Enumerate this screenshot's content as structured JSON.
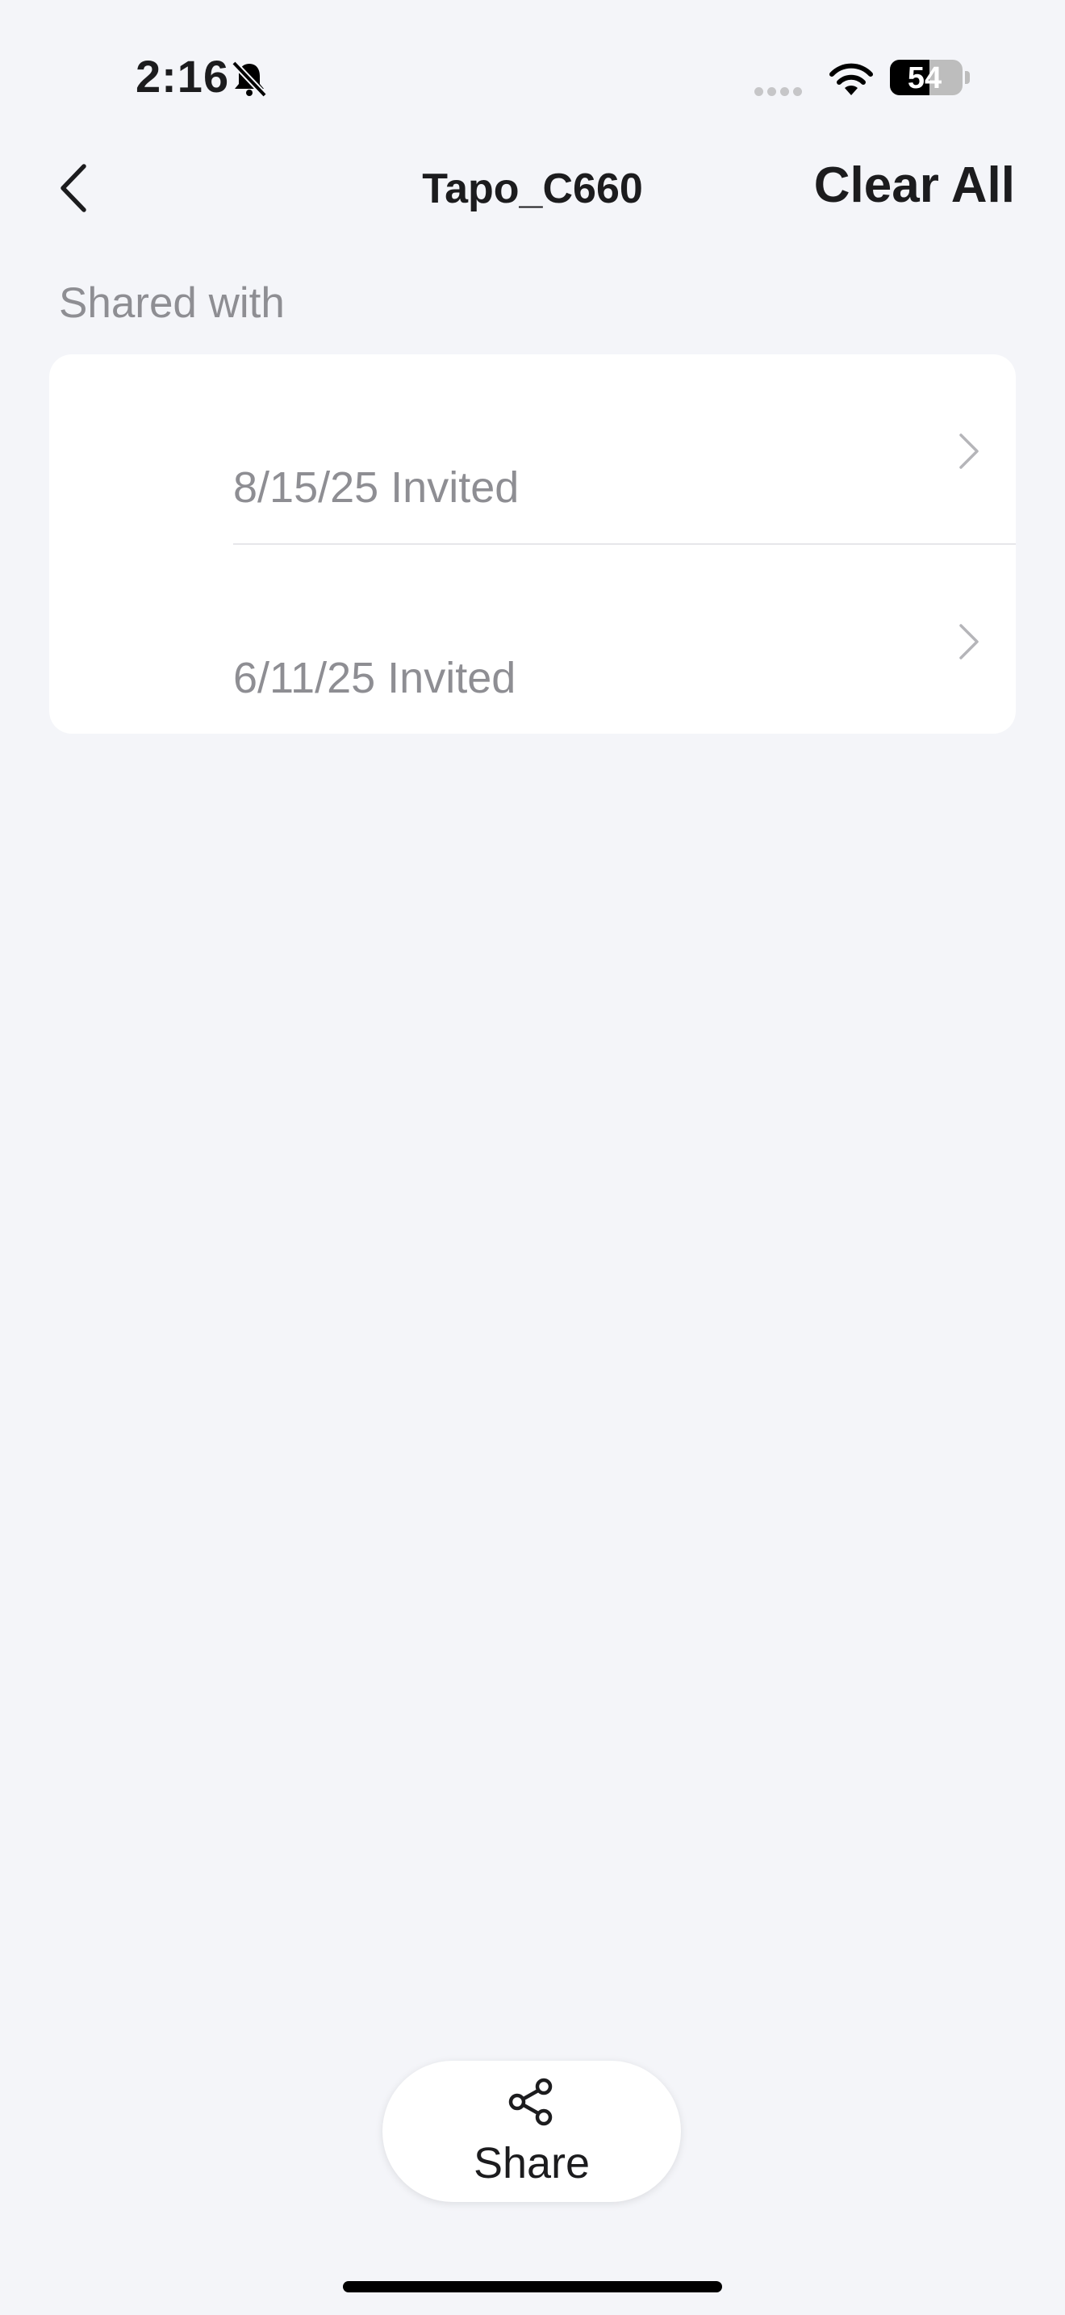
{
  "status_bar": {
    "time": "2:16",
    "battery": "54",
    "battery_level": 0.54,
    "icons": [
      "bell-slash-icon",
      "signal-icon",
      "wifi-icon",
      "battery-icon"
    ]
  },
  "nav": {
    "title": "Tapo_C660",
    "clear_all": "Clear All",
    "back_icon": "chevron-left-icon"
  },
  "section": {
    "label": "Shared with"
  },
  "shares": [
    {
      "date": "8/15/25 Invited",
      "icon": "chevron-right-icon"
    },
    {
      "date": "6/11/25 Invited",
      "icon": "chevron-right-icon"
    }
  ],
  "share_button": {
    "label": "Share",
    "icon": "share-icon"
  },
  "colors": {
    "background": "#f4f5f9",
    "card": "#ffffff",
    "secondary_text": "#8e8e93",
    "primary_text": "#1c1c1e"
  }
}
